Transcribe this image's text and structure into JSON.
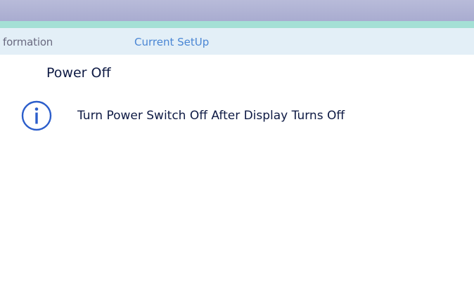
{
  "tabs": {
    "information_label": "formation",
    "current_setup_label": "Current SetUp"
  },
  "main": {
    "title": "Power Off",
    "message": "Turn Power Switch Off After Display Turns Off",
    "icon": "info-icon"
  },
  "colors": {
    "top_bar": "#aeb1d3",
    "accent_strip": "#a4e0d5",
    "tab_bar": "#e3eff7",
    "tab_active_text": "#4a86d4",
    "icon_stroke": "#2c5ecb",
    "body_text": "#0e1a44"
  }
}
